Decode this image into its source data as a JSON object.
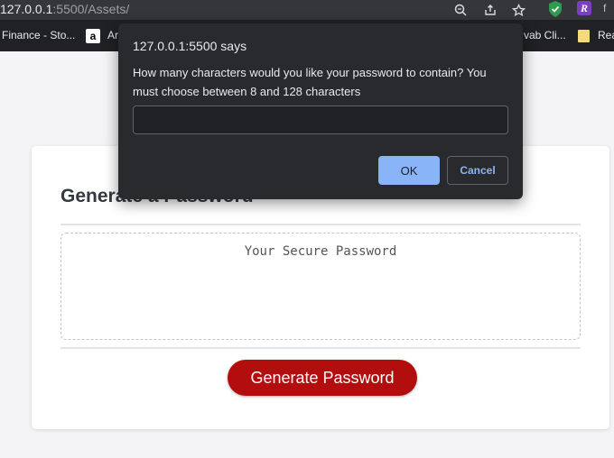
{
  "browser": {
    "url_host": "127.0.0.1",
    "url_path": ":5500/Assets/",
    "ext_r_letter": "R",
    "ext_f_letter": "f"
  },
  "bookmarks": {
    "items": [
      {
        "label": "Finance - Sto..."
      },
      {
        "label": "Ar"
      },
      {
        "label": "vab Cli..."
      },
      {
        "label": "Rea"
      }
    ],
    "amazon_glyph": "a"
  },
  "page": {
    "title": "Generate a Password",
    "password_placeholder": "Your Secure Password",
    "generate_label": "Generate Password",
    "button_color": "#b30e0e"
  },
  "dialog": {
    "title": "127.0.0.1:5500 says",
    "message": "How many characters would you like your password to contain? You must choose between 8 and 128 characters",
    "input_value": "",
    "ok_label": "OK",
    "cancel_label": "Cancel"
  }
}
